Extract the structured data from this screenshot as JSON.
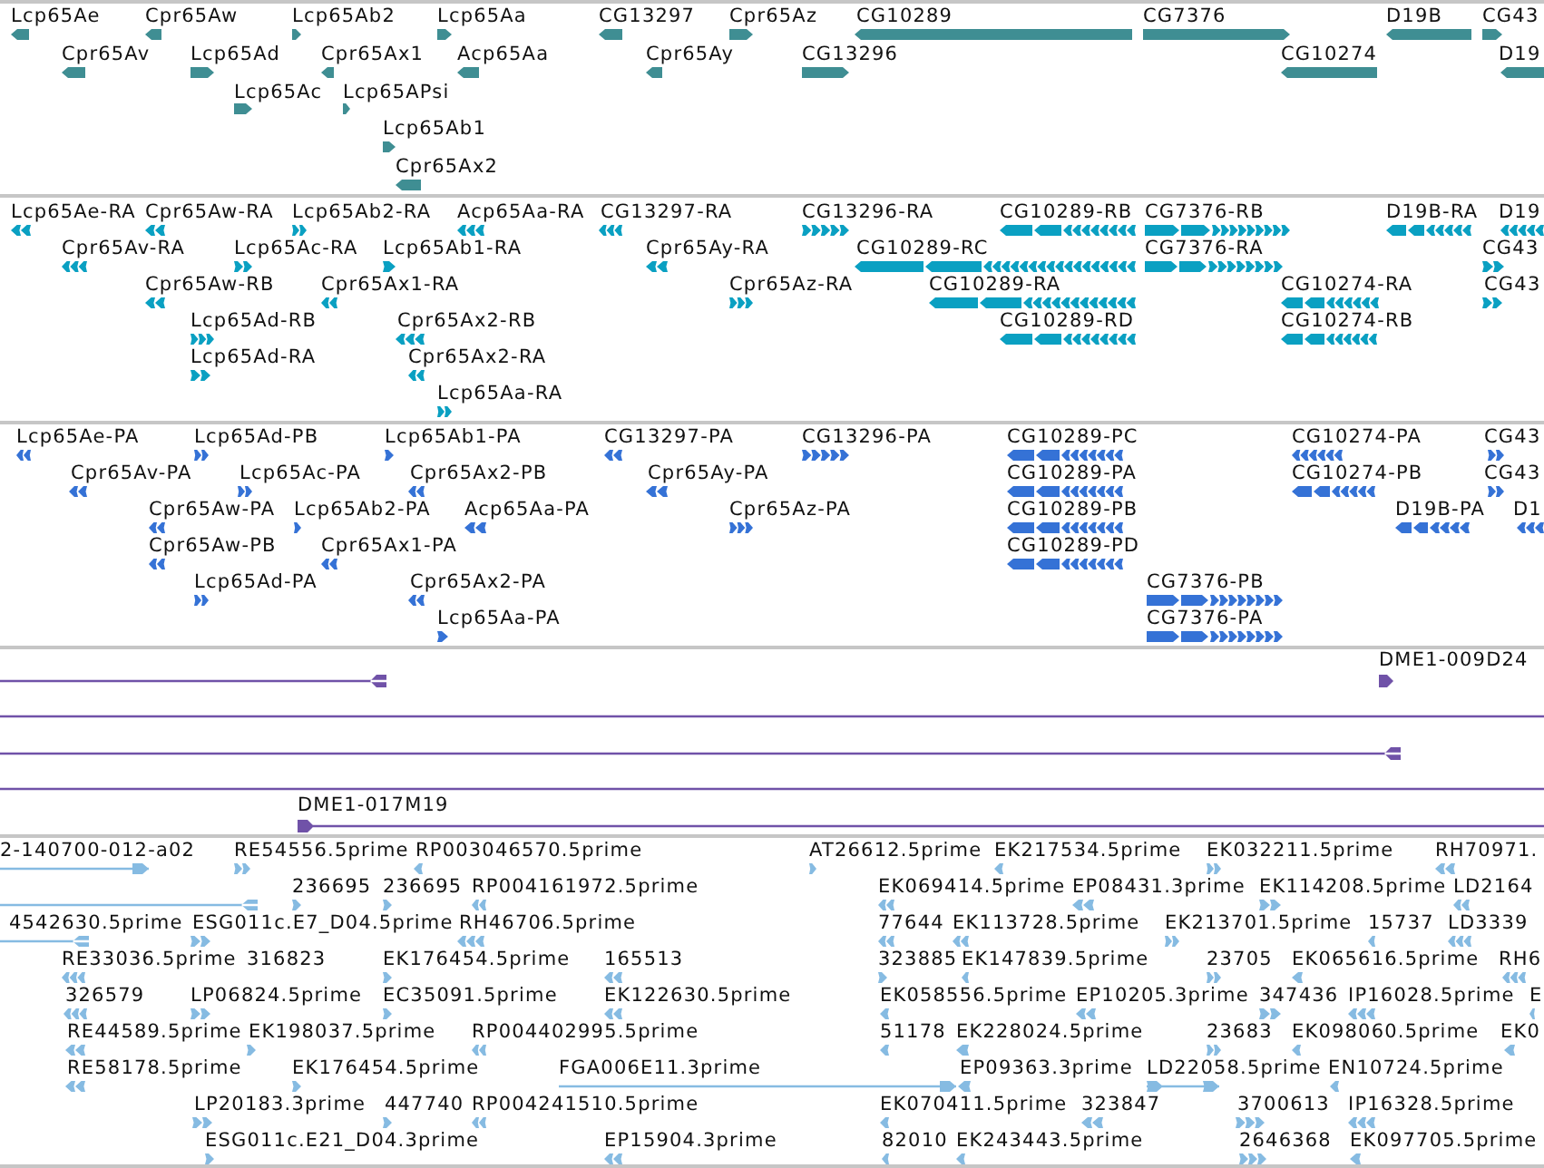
{
  "tracks": [
    {
      "kind": "gene",
      "features": [
        {
          "label": "Lcp65Ae",
          "reverse": true
        },
        {
          "label": "Cpr65Aw",
          "reverse": true
        },
        {
          "label": "Lcp65Ab2",
          "reverse": false
        },
        {
          "label": "Lcp65Aa",
          "reverse": false
        },
        {
          "label": "CG13297",
          "reverse": true
        },
        {
          "label": "Cpr65Az",
          "reverse": false
        },
        {
          "label": "CG10289",
          "reverse": true
        },
        {
          "label": "CG7376",
          "reverse": false
        },
        {
          "label": "D19B",
          "reverse": true
        },
        {
          "label": "CG43",
          "reverse": false
        },
        {
          "label": "Cpr65Av",
          "reverse": true
        },
        {
          "label": "Lcp65Ad",
          "reverse": false
        },
        {
          "label": "Cpr65Ax1",
          "reverse": true
        },
        {
          "label": "Acp65Aa",
          "reverse": true
        },
        {
          "label": "Cpr65Ay",
          "reverse": true
        },
        {
          "label": "CG13296",
          "reverse": false
        },
        {
          "label": "CG10274",
          "reverse": true
        },
        {
          "label": "D19",
          "reverse": true
        },
        {
          "label": "Lcp65Ac",
          "reverse": false
        },
        {
          "label": "Lcp65APsi",
          "reverse": false
        },
        {
          "label": "Lcp65Ab1",
          "reverse": false
        },
        {
          "label": "Cpr65Ax2",
          "reverse": true
        }
      ]
    },
    {
      "kind": "transcript",
      "features": [
        {
          "label": "Lcp65Ae-RA",
          "reverse": true
        },
        {
          "label": "Cpr65Aw-RA",
          "reverse": true
        },
        {
          "label": "Lcp65Ab2-RA",
          "reverse": false
        },
        {
          "label": "Acp65Aa-RA",
          "reverse": true
        },
        {
          "label": "CG13297-RA",
          "reverse": true
        },
        {
          "label": "CG13296-RA",
          "reverse": false
        },
        {
          "label": "CG10289-RB",
          "reverse": true
        },
        {
          "label": "CG7376-RB",
          "reverse": false
        },
        {
          "label": "D19B-RA",
          "reverse": true
        },
        {
          "label": "D19",
          "reverse": true
        },
        {
          "label": "Cpr65Av-RA",
          "reverse": true
        },
        {
          "label": "Lcp65Ac-RA",
          "reverse": false
        },
        {
          "label": "Lcp65Ab1-RA",
          "reverse": false
        },
        {
          "label": "Cpr65Ay-RA",
          "reverse": true
        },
        {
          "label": "CG10289-RC",
          "reverse": true
        },
        {
          "label": "CG7376-RA",
          "reverse": false
        },
        {
          "label": "CG43",
          "reverse": false
        },
        {
          "label": "Cpr65Aw-RB",
          "reverse": true
        },
        {
          "label": "Cpr65Ax1-RA",
          "reverse": true
        },
        {
          "label": "Cpr65Az-RA",
          "reverse": false
        },
        {
          "label": "CG10289-RA",
          "reverse": true
        },
        {
          "label": "CG10274-RA",
          "reverse": true
        },
        {
          "label": "CG43",
          "reverse": false
        },
        {
          "label": "Lcp65Ad-RB",
          "reverse": false
        },
        {
          "label": "Cpr65Ax2-RB",
          "reverse": true
        },
        {
          "label": "CG10289-RD",
          "reverse": true
        },
        {
          "label": "CG10274-RB",
          "reverse": true
        },
        {
          "label": "Lcp65Ad-RA",
          "reverse": false
        },
        {
          "label": "Cpr65Ax2-RA",
          "reverse": true
        },
        {
          "label": "Lcp65Aa-RA",
          "reverse": false
        }
      ]
    },
    {
      "kind": "protein",
      "features": [
        {
          "label": "Lcp65Ae-PA",
          "reverse": true
        },
        {
          "label": "Lcp65Ad-PB",
          "reverse": false
        },
        {
          "label": "Lcp65Ab1-PA",
          "reverse": false
        },
        {
          "label": "CG13297-PA",
          "reverse": true
        },
        {
          "label": "CG13296-PA",
          "reverse": false
        },
        {
          "label": "CG10289-PC",
          "reverse": true
        },
        {
          "label": "CG10274-PA",
          "reverse": true
        },
        {
          "label": "CG43",
          "reverse": false
        },
        {
          "label": "Cpr65Av-PA",
          "reverse": true
        },
        {
          "label": "Lcp65Ac-PA",
          "reverse": false
        },
        {
          "label": "Cpr65Ax2-PB",
          "reverse": true
        },
        {
          "label": "Cpr65Ay-PA",
          "reverse": true
        },
        {
          "label": "CG10289-PA",
          "reverse": true
        },
        {
          "label": "CG10274-PB",
          "reverse": true
        },
        {
          "label": "CG43",
          "reverse": false
        },
        {
          "label": "Cpr65Aw-PA",
          "reverse": true
        },
        {
          "label": "Lcp65Ab2-PA",
          "reverse": false
        },
        {
          "label": "Acp65Aa-PA",
          "reverse": true
        },
        {
          "label": "Cpr65Az-PA",
          "reverse": false
        },
        {
          "label": "CG10289-PB",
          "reverse": true
        },
        {
          "label": "D19B-PA",
          "reverse": true
        },
        {
          "label": "D1",
          "reverse": true
        },
        {
          "label": "Cpr65Aw-PB",
          "reverse": true
        },
        {
          "label": "Cpr65Ax1-PA",
          "reverse": true
        },
        {
          "label": "CG10289-PD",
          "reverse": true
        },
        {
          "label": "Lcp65Ad-PA",
          "reverse": false
        },
        {
          "label": "Cpr65Ax2-PA",
          "reverse": true
        },
        {
          "label": "CG7376-PB",
          "reverse": false
        },
        {
          "label": "Lcp65Aa-PA",
          "reverse": false
        },
        {
          "label": "CG7376-PA",
          "reverse": false
        }
      ]
    },
    {
      "kind": "clone",
      "features": [
        {
          "kind": "arrow",
          "reverse": true
        },
        {
          "label": "DME1-009D24",
          "kind": "arrow",
          "reverse": false
        },
        {
          "kind": "line"
        },
        {
          "kind": "arrow",
          "reverse": true
        },
        {
          "kind": "line"
        },
        {
          "label": "DME1-017M19",
          "kind": "arrow",
          "reverse": false
        }
      ]
    },
    {
      "kind": "est",
      "features": [
        {
          "label": "2-140700-012-a02",
          "reverse": false
        },
        {
          "label": "RE54556.5prime",
          "reverse": false
        },
        {
          "label": "RP003046570.5prime",
          "reverse": true
        },
        {
          "label": "AT26612.5prime",
          "reverse": false
        },
        {
          "label": "EK217534.5prime",
          "reverse": true
        },
        {
          "label": "EK032211.5prime",
          "reverse": false
        },
        {
          "label": "RH70971.",
          "reverse": true
        },
        {
          "reverse": true
        },
        {
          "label": "236695",
          "reverse": false
        },
        {
          "label": "236695",
          "reverse": false
        },
        {
          "label": "RP004161972.5prime",
          "reverse": true
        },
        {
          "label": "EK069414.5prime",
          "reverse": true
        },
        {
          "label": "EP08431.3prime",
          "reverse": true
        },
        {
          "label": "EK114208.5prime",
          "reverse": false
        },
        {
          "label": "LD2164",
          "reverse": true
        },
        {
          "label": "4542630.5prime",
          "reverse": true
        },
        {
          "label": "ESG011c.E7_D04.5prime",
          "reverse": false
        },
        {
          "label": "RH46706.5prime",
          "reverse": true
        },
        {
          "label": "77644",
          "reverse": true
        },
        {
          "label": "EK113728.5prime",
          "reverse": true
        },
        {
          "label": "EK213701.5prime",
          "reverse": false
        },
        {
          "label": "15737",
          "reverse": true
        },
        {
          "label": "LD3339",
          "reverse": true
        },
        {
          "label": "RE33036.5prime",
          "reverse": true
        },
        {
          "label": "316823"
        },
        {
          "label": "EK176454.5prime",
          "reverse": false
        },
        {
          "label": "165513",
          "reverse": true
        },
        {
          "label": "323885",
          "reverse": false
        },
        {
          "label": "EK147839.5prime",
          "reverse": true
        },
        {
          "label": "23705",
          "reverse": false
        },
        {
          "label": "EK065616.5prime",
          "reverse": true
        },
        {
          "label": "RH6",
          "reverse": true
        },
        {
          "label": "326579",
          "reverse": true
        },
        {
          "label": "LP06824.5prime",
          "reverse": false
        },
        {
          "label": "EC35091.5prime",
          "reverse": false
        },
        {
          "label": "EK122630.5prime",
          "reverse": true
        },
        {
          "label": "EK058556.5prime",
          "reverse": true
        },
        {
          "label": "EP10205.3prime",
          "reverse": true
        },
        {
          "label": "347436",
          "reverse": false
        },
        {
          "label": "IP16028.5prime",
          "reverse": true
        },
        {
          "label": "E",
          "reverse": true
        },
        {
          "label": "RE44589.5prime",
          "reverse": true
        },
        {
          "label": "EK198037.5prime",
          "reverse": false
        },
        {
          "label": "RP004402995.5prime",
          "reverse": true
        },
        {
          "label": "51178",
          "reverse": true
        },
        {
          "label": "EK228024.5prime",
          "reverse": true
        },
        {
          "label": "23683",
          "reverse": false
        },
        {
          "label": "EK098060.5prime",
          "reverse": true
        },
        {
          "label": "EK0",
          "reverse": true
        },
        {
          "label": "RE58178.5prime",
          "reverse": true
        },
        {
          "label": "EK176454.5prime",
          "reverse": false
        },
        {
          "label": "FGA006E11.3prime",
          "reverse": false
        },
        {
          "label": "EP09363.3prime",
          "reverse": true
        },
        {
          "label": "LD22058.5prime",
          "reverse": false
        },
        {
          "label": "EN10724.5prime",
          "reverse": true
        },
        {
          "label": "LP20183.3prime",
          "reverse": false
        },
        {
          "label": "447740",
          "reverse": false
        },
        {
          "label": "RP004241510.5prime",
          "reverse": true
        },
        {
          "label": "EK070411.5prime",
          "reverse": true
        },
        {
          "label": "323847",
          "reverse": true
        },
        {
          "label": "3700613",
          "reverse": false
        },
        {
          "label": "IP16328.5prime",
          "reverse": true
        },
        {
          "label": "ESG011c.E21_D04.3prime",
          "reverse": false
        },
        {
          "label": "EP15904.3prime",
          "reverse": true
        },
        {
          "label": "82010",
          "reverse": true
        },
        {
          "label": "EK243443.5prime",
          "reverse": true
        },
        {
          "label": "2646368",
          "reverse": false
        },
        {
          "label": "EK097705.5prime",
          "reverse": true
        }
      ]
    }
  ]
}
